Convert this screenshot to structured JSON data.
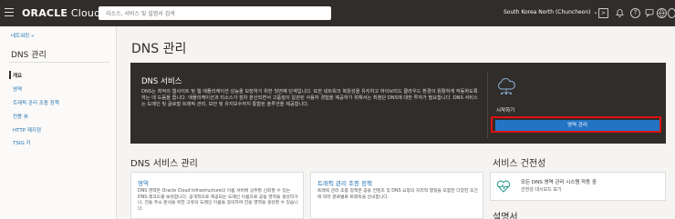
{
  "topbar": {
    "logo_brand": "ORACLE",
    "logo_product": "Cloud",
    "search_placeholder": "리소스, 서비스 및 설명서 검색",
    "region": "South Korea North (Chuncheon)"
  },
  "sidebar": {
    "breadcrumb": "네트워킹 »",
    "title": "DNS 관리",
    "items": [
      {
        "label": "개요",
        "active": true
      },
      {
        "label": "영역",
        "active": false
      },
      {
        "label": "트래픽 관리 조종 정책",
        "active": false
      },
      {
        "label": "전용 뷰",
        "active": false
      },
      {
        "label": "HTTP 재지정",
        "active": false
      },
      {
        "label": "TSIG 키",
        "active": false
      }
    ]
  },
  "main": {
    "title": "DNS 관리",
    "banner": {
      "title": "DNS 서비스",
      "text": "DNS는 최적의 웹사이트 및 웹 애플리케이션 성능을 보장하기 위한 첫번째 단계입니다. 또한 네트워크 복원성을 유지하고 하이브리드 클라우드 환경이 원활하게 작동하도록 하는 데 도움을 줍니다. 애플리케이션과 리소스가 점차 분산되면서 고품질의 일관된 사용자 경험을 제공하기 위해서는 최첨단 DNS에 대한 투자가 필요합니다. DNS 서비스는 도메인 및 글로벌 트래픽 관리, 보안 및 유지보수까지 통합된 솔루션을 제공합니다.",
      "start_label": "시작하기",
      "primary_button": "영역 관리"
    },
    "service_section": {
      "title": "DNS 서비스 관리",
      "cards": [
        {
          "title": "영역",
          "text": "DNS 영역은 Oracle Cloud Infrastructure의 이름 서버에 상주할 신뢰할 수 있는 DNS 레코드를 보유합니다. 공개적으로 제공되는 도메인 이름으로 공용 영역을 생성하거나, 전용 주소 분석을 위한 고유의 도메인 이름을 정의하여 전용 영역을 생성할 수 있습니다."
        },
        {
          "title": "트래픽 관리 조종 정책",
          "text": "트래픽 관리 조종 정책은 공용 컨텐츠 및 DNS 요청의 지리적 행정을 포함한 다양한 조건에 따라 글로벌로 트래픽을 안내합니다."
        }
      ]
    },
    "health_section": {
      "title": "서비스 건전성",
      "status_text": "모든 DNS 영역 관리 시스템 작동 중",
      "link_text": "건전성 대시보드 보기"
    },
    "docs_section": {
      "title": "설명서"
    }
  },
  "colors": {
    "topbar_bg": "#312d2a",
    "banner_bg": "#312d2a",
    "primary_button": "#2474c4",
    "link": "#1f6fb0",
    "health_accent": "#2a9b8c",
    "highlight_border": "#dd1111"
  },
  "icons": [
    "hamburger-icon",
    "region-dropdown-chevron-icon",
    "code-editor-icon",
    "bell-icon",
    "help-icon",
    "chat-icon",
    "language-icon",
    "profile-icon",
    "cloud-dns-icon",
    "health-pulse-icon"
  ]
}
